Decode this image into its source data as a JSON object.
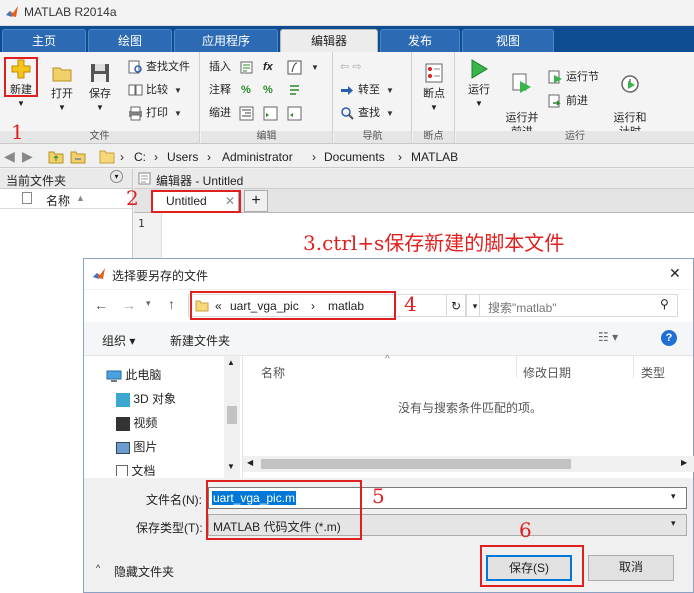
{
  "window": {
    "title": "MATLAB R2014a"
  },
  "tabs": [
    "主页",
    "绘图",
    "应用程序",
    "编辑器",
    "发布",
    "视图"
  ],
  "ribbon": {
    "file": {
      "new": "新建",
      "open": "打开",
      "save": "保存",
      "find_files": "查找文件",
      "compare": "比较",
      "print": "打印",
      "group": "文件"
    },
    "edit": {
      "insert": "插入",
      "comment": "注释",
      "indent": "缩进",
      "fx": "fx",
      "group": "编辑"
    },
    "nav": {
      "goto": "转至",
      "find": "查找",
      "group": "导航"
    },
    "breakpoints": {
      "label": "断点",
      "group": "断点"
    },
    "run": {
      "run": "运行",
      "run_advance": "运行并\n前进",
      "run_section": "运行节",
      "advance": "前进",
      "run_time": "运行和\n计时",
      "group": "运行"
    }
  },
  "address": {
    "crumbs": [
      "C:",
      "Users",
      "Administrator",
      "Documents",
      "MATLAB"
    ]
  },
  "current_folder": {
    "title": "当前文件夹",
    "name_col": "名称"
  },
  "editor": {
    "title": "编辑器 - Untitled",
    "tab": "Untitled",
    "line1": "1"
  },
  "annotations": {
    "n1": "1",
    "n2": "2",
    "n3": "3.ctrl+s保存新建的脚本文件",
    "n4": "4",
    "n5": "5",
    "n6": "6"
  },
  "dialog": {
    "title": "选择要另存的文件",
    "path": [
      "«",
      "uart_vga_pic",
      "›",
      "matlab"
    ],
    "search_placeholder": "搜索\"matlab\"",
    "organize": "组织 ▾",
    "new_folder": "新建文件夹",
    "tree": [
      "此电脑",
      "3D 对象",
      "视频",
      "图片",
      "文档"
    ],
    "cols": {
      "name": "名称",
      "date": "修改日期",
      "type": "类型"
    },
    "empty_msg": "没有与搜索条件匹配的项。",
    "filename_label": "文件名(N):",
    "filename_value": "uart_vga_pic.m",
    "type_label": "保存类型(T):",
    "type_value": "MATLAB 代码文件 (*.m)",
    "hide_folders": "隐藏文件夹",
    "save_btn": "保存(S)",
    "cancel_btn": "取消"
  }
}
